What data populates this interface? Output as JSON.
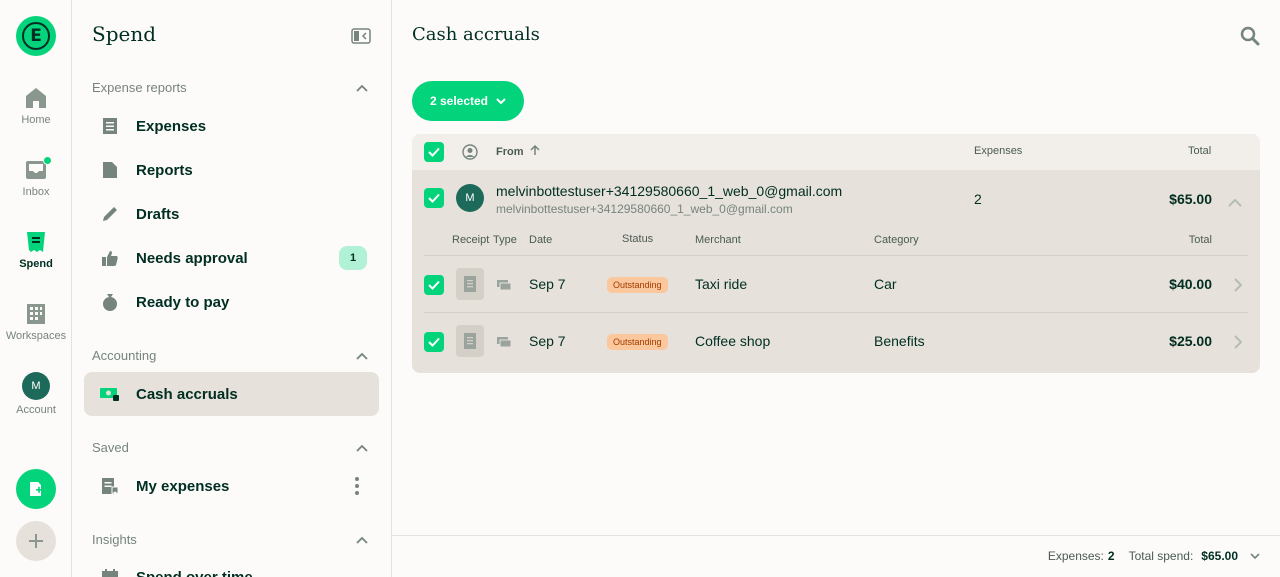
{
  "rail": {
    "logo_letter": "E",
    "items": [
      {
        "label": "Home",
        "icon": "home-icon"
      },
      {
        "label": "Inbox",
        "icon": "inbox-icon"
      },
      {
        "label": "Spend",
        "icon": "receipt-icon"
      },
      {
        "label": "Workspaces",
        "icon": "building-icon"
      },
      {
        "label": "Account",
        "icon": "avatar"
      }
    ],
    "account_initial": "M"
  },
  "sidebar": {
    "title": "Spend",
    "sections": {
      "expense_reports": "Expense reports",
      "accounting": "Accounting",
      "saved": "Saved",
      "insights": "Insights"
    },
    "items": {
      "expenses": "Expenses",
      "reports": "Reports",
      "drafts": "Drafts",
      "needs_approval": "Needs approval",
      "needs_approval_count": "1",
      "ready_to_pay": "Ready to pay",
      "cash_accruals": "Cash accruals",
      "my_expenses": "My expenses",
      "spend_over_time": "Spend over time"
    }
  },
  "main": {
    "title": "Cash accruals",
    "selected_label": "2 selected",
    "table": {
      "headers": {
        "from": "From",
        "expenses": "Expenses",
        "total": "Total"
      },
      "group": {
        "avatar": "M",
        "name": "melvinbottestuser+34129580660_1_web_0@gmail.com",
        "email": "melvinbottestuser+34129580660_1_web_0@gmail.com",
        "expenses": "2",
        "total": "$65.00"
      },
      "sub_headers": {
        "receipt": "Receipt",
        "type": "Type",
        "date": "Date",
        "status": "Status",
        "merchant": "Merchant",
        "category": "Category",
        "total": "Total"
      },
      "rows": [
        {
          "date": "Sep 7",
          "status": "Outstanding",
          "merchant": "Taxi ride",
          "category": "Car",
          "total": "$40.00"
        },
        {
          "date": "Sep 7",
          "status": "Outstanding",
          "merchant": "Coffee shop",
          "category": "Benefits",
          "total": "$25.00"
        }
      ]
    },
    "footer": {
      "expenses_label": "Expenses:",
      "expenses_count": "2",
      "total_label": "Total spend:",
      "total_value": "$65.00"
    }
  },
  "colors": {
    "accent": "#03d47c",
    "dark": "#002e22",
    "muted": "#76847e"
  }
}
